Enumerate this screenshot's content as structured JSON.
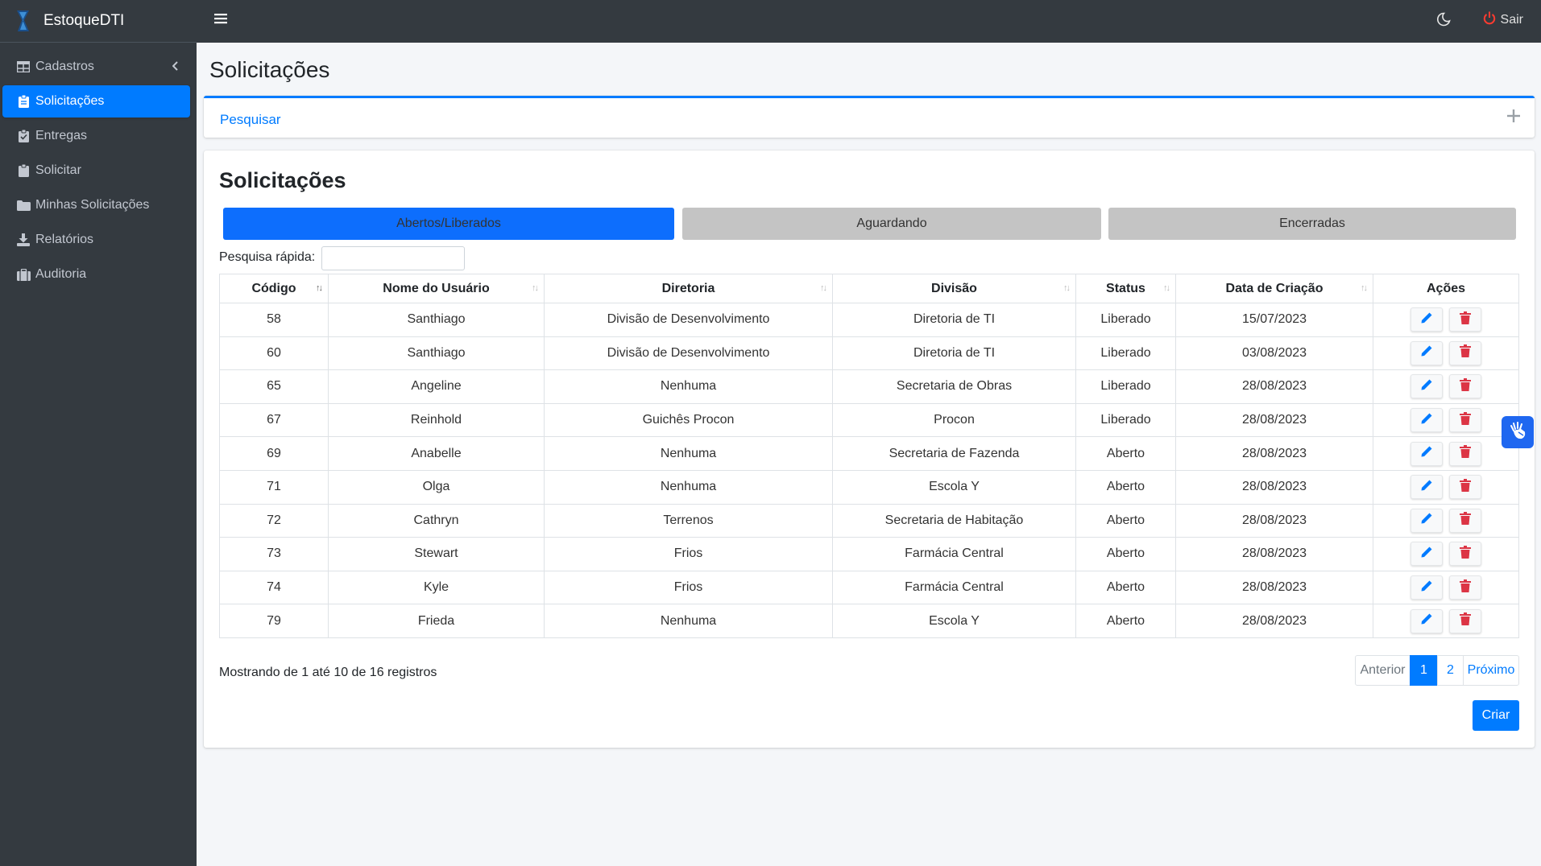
{
  "brand": {
    "name": "EstoqueDTI"
  },
  "sidebar": {
    "items": [
      {
        "label": "Cadastros",
        "icon": "table-icon"
      },
      {
        "label": "Solicitações",
        "icon": "clipboard-icon"
      },
      {
        "label": "Entregas",
        "icon": "clipboard-check-icon"
      },
      {
        "label": "Solicitar",
        "icon": "clipboard-icon"
      },
      {
        "label": "Minhas Solicitações",
        "icon": "folder-icon"
      },
      {
        "label": "Relatórios",
        "icon": "download-icon"
      },
      {
        "label": "Auditoria",
        "icon": "suitcase-icon"
      }
    ]
  },
  "topbar": {
    "logout_label": "Sair"
  },
  "page": {
    "title": "Solicitações"
  },
  "search_card": {
    "title": "Pesquisar"
  },
  "main_card": {
    "title": "Solicitações",
    "tabs": [
      "Abertos/Liberados",
      "Aguardando",
      "Encerradas"
    ],
    "quick_search_label": "Pesquisa rápida:",
    "quick_search_value": ""
  },
  "table": {
    "headers": [
      "Código",
      "Nome do Usuário",
      "Diretoria",
      "Divisão",
      "Status",
      "Data de Criação",
      "Ações"
    ],
    "rows": [
      [
        "58",
        "Santhiago",
        "Divisão de Desenvolvimento",
        "Diretoria de TI",
        "Liberado",
        "15/07/2023"
      ],
      [
        "60",
        "Santhiago",
        "Divisão de Desenvolvimento",
        "Diretoria de TI",
        "Liberado",
        "03/08/2023"
      ],
      [
        "65",
        "Angeline",
        "Nenhuma",
        "Secretaria de Obras",
        "Liberado",
        "28/08/2023"
      ],
      [
        "67",
        "Reinhold",
        "Guichês Procon",
        "Procon",
        "Liberado",
        "28/08/2023"
      ],
      [
        "69",
        "Anabelle",
        "Nenhuma",
        "Secretaria de Fazenda",
        "Aberto",
        "28/08/2023"
      ],
      [
        "71",
        "Olga",
        "Nenhuma",
        "Escola Y",
        "Aberto",
        "28/08/2023"
      ],
      [
        "72",
        "Cathryn",
        "Terrenos",
        "Secretaria de Habitação",
        "Aberto",
        "28/08/2023"
      ],
      [
        "73",
        "Stewart",
        "Frios",
        "Farmácia Central",
        "Aberto",
        "28/08/2023"
      ],
      [
        "74",
        "Kyle",
        "Frios",
        "Farmácia Central",
        "Aberto",
        "28/08/2023"
      ],
      [
        "79",
        "Frieda",
        "Nenhuma",
        "Escola Y",
        "Aberto",
        "28/08/2023"
      ]
    ]
  },
  "footer": {
    "info": "Mostrando de 1 até 10 de 16 registros",
    "pagination": [
      "Anterior",
      "1",
      "2",
      "Próximo"
    ],
    "create_label": "Criar"
  },
  "colors": {
    "primary": "#007bff",
    "sidebar": "#343a40",
    "danger": "#dc3545"
  }
}
